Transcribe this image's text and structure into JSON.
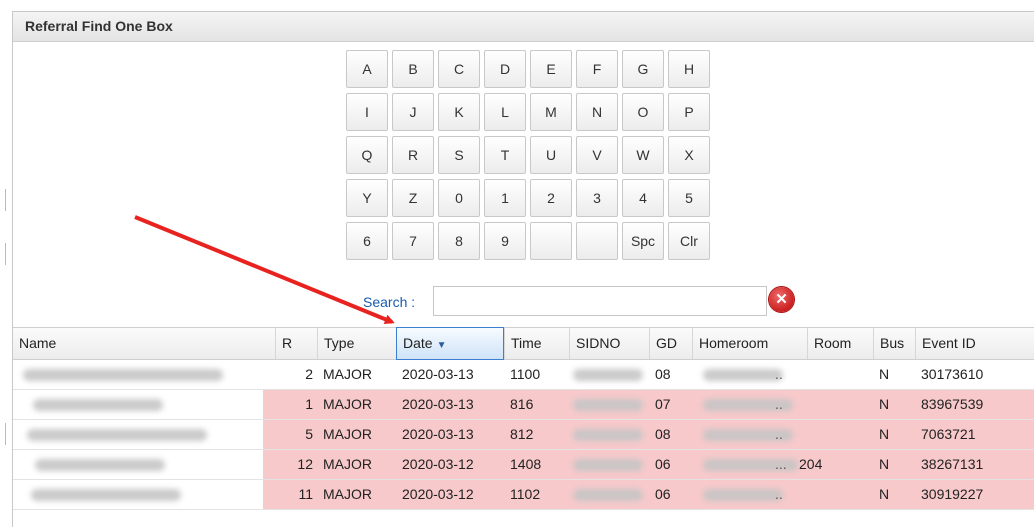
{
  "dialog": {
    "title": "Referral Find One Box"
  },
  "keypad": {
    "rows": [
      [
        "A",
        "B",
        "C",
        "D",
        "E",
        "F",
        "G",
        "H"
      ],
      [
        "I",
        "J",
        "K",
        "L",
        "M",
        "N",
        "O",
        "P"
      ],
      [
        "Q",
        "R",
        "S",
        "T",
        "U",
        "V",
        "W",
        "X"
      ],
      [
        "Y",
        "Z",
        "0",
        "1",
        "2",
        "3",
        "4",
        "5"
      ],
      [
        "6",
        "7",
        "8",
        "9",
        "",
        "",
        "Spc",
        "Clr"
      ]
    ]
  },
  "search": {
    "label": "Search :",
    "value": ""
  },
  "table": {
    "columns": [
      "Name",
      "R",
      "Type",
      "Date",
      "Time",
      "SIDNO",
      "GD",
      "Homeroom",
      "Room",
      "Bus",
      "Event ID"
    ],
    "sorted_column": "Date",
    "rows": [
      {
        "r": "2",
        "type": "MAJOR",
        "date": "2020-03-13",
        "time": "1100",
        "gd": "08",
        "homeroom": "..",
        "room": "",
        "bus": "N",
        "event_id": "30173610",
        "style": "white"
      },
      {
        "r": "1",
        "type": "MAJOR",
        "date": "2020-03-13",
        "time": "816",
        "gd": "07",
        "homeroom": "..",
        "room": "",
        "bus": "N",
        "event_id": "83967539",
        "style": "pink"
      },
      {
        "r": "5",
        "type": "MAJOR",
        "date": "2020-03-13",
        "time": "812",
        "gd": "08",
        "homeroom": "..",
        "room": "",
        "bus": "N",
        "event_id": "7063721",
        "style": "pink"
      },
      {
        "r": "12",
        "type": "MAJOR",
        "date": "2020-03-12",
        "time": "1408",
        "gd": "06",
        "homeroom": "...",
        "room": "204",
        "bus": "N",
        "event_id": "38267131",
        "style": "pink"
      },
      {
        "r": "11",
        "type": "MAJOR",
        "date": "2020-03-12",
        "time": "1102",
        "gd": "06",
        "homeroom": "..",
        "room": "",
        "bus": "N",
        "event_id": "30919227",
        "style": "pink"
      }
    ]
  },
  "annotation": {
    "arrow_color": "#e8231f"
  }
}
